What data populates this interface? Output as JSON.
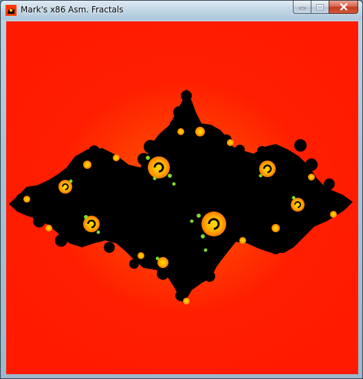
{
  "window": {
    "title": "Mark's x86 Asm. Fractals",
    "icon": "fractal-app-icon"
  },
  "caption_buttons": [
    {
      "name": "minimize-button",
      "icon": "minimize-icon"
    },
    {
      "name": "maximize-button",
      "icon": "maximize-icon"
    },
    {
      "name": "close-button",
      "icon": "close-icon"
    }
  ],
  "canvas": {
    "content": "julia-set-fractal",
    "colors": {
      "background_outer": "#ff1a00",
      "background_inner": "#ff6a00",
      "set_interior": "#000000",
      "spiral_highlight": "#ffd000",
      "edge_accent": "#7fd92a"
    }
  }
}
